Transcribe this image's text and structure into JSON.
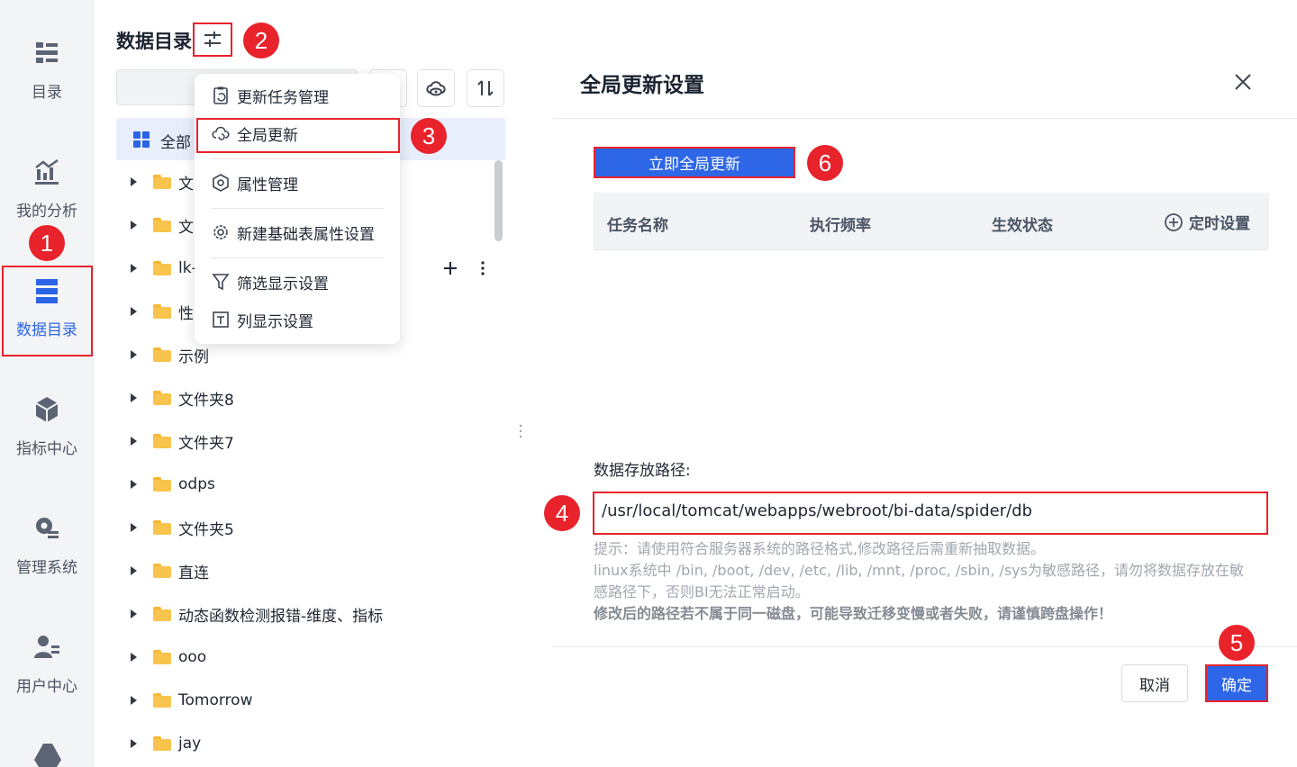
{
  "nav": {
    "items": [
      {
        "label": "目录",
        "icon": "catalog-list-icon"
      },
      {
        "label": "我的分析",
        "icon": "analysis-chart-icon"
      },
      {
        "label": "数据目录",
        "icon": "data-catalog-icon",
        "active": true
      },
      {
        "label": "指标中心",
        "icon": "metrics-cube-icon"
      },
      {
        "label": "管理系统",
        "icon": "admin-gear-icon"
      },
      {
        "label": "用户中心",
        "icon": "user-icon"
      }
    ]
  },
  "catalog": {
    "title": "数据目录",
    "all_label": "全部",
    "folders": [
      "文",
      "文",
      "lk-",
      "性",
      "示例",
      "文件夹8",
      "文件夹7",
      "odps",
      "文件夹5",
      "直连",
      "动态函数检测报错-维度、指标",
      "ooo",
      "Tomorrow",
      "jay"
    ]
  },
  "menu": {
    "items": [
      {
        "label": "更新任务管理",
        "icon": "clipboard-refresh-icon"
      },
      {
        "label": "全局更新",
        "icon": "cloud-refresh-icon"
      },
      {
        "label": "属性管理",
        "icon": "hexagon-settings-icon"
      },
      {
        "label": "新建基础表属性设置",
        "icon": "gear-icon"
      },
      {
        "label": "筛选显示设置",
        "icon": "filter-icon"
      },
      {
        "label": "列显示设置",
        "icon": "column-icon"
      }
    ]
  },
  "dialog": {
    "title": "全局更新设置",
    "update_now": "立即全局更新",
    "columns": [
      "任务名称",
      "执行频率",
      "生效状态"
    ],
    "schedule_label": "定时设置",
    "path_label": "数据存放路径:",
    "path_value": "/usr/local/tomcat/webapps/webroot/bi-data/spider/db",
    "hint_1": "提示：请使用符合服务器系统的路径格式,修改路径后需重新抽取数据。",
    "hint_2": "linux系统中 /bin, /boot, /dev, /etc, /lib, /mnt, /proc, /sbin, /sys为敏感路径，请勿将数据存放在敏",
    "hint_3": "感路径下，否则BI无法正常启动。",
    "hint_4": "修改后的路径若不属于同一磁盘，可能导致迁移变慢或者失败，请谨慎跨盘操作！",
    "cancel": "取消",
    "confirm": "确定"
  },
  "badges": [
    "1",
    "2",
    "3",
    "4",
    "5",
    "6"
  ],
  "colors": {
    "accent": "#2d66e6",
    "highlight": "#e8232b",
    "folder": "#f9c44d"
  }
}
